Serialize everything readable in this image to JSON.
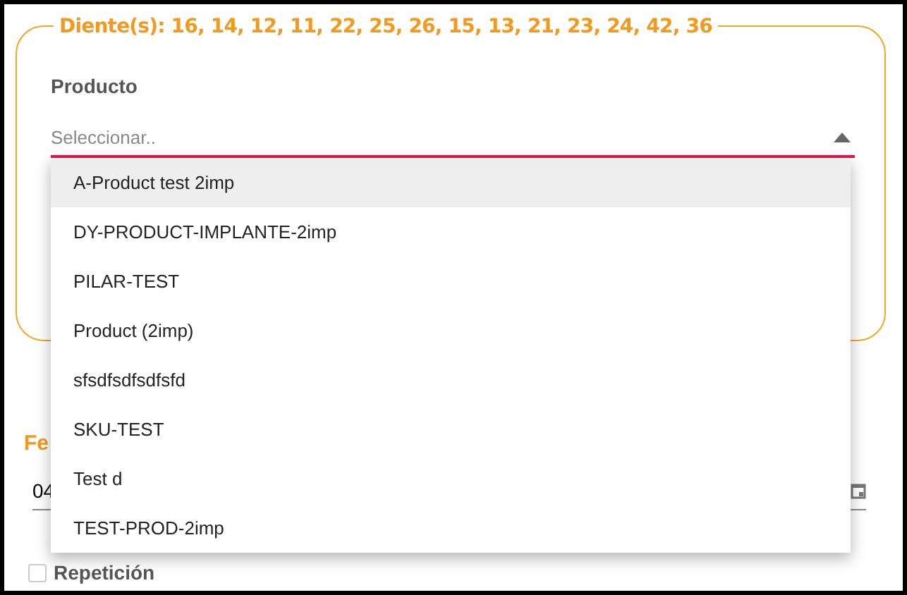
{
  "fieldset": {
    "legend": "Diente(s): 16, 14, 12, 11, 22, 25, 26, 15, 13, 21, 23, 24, 42, 36"
  },
  "product_select": {
    "label": "Producto",
    "placeholder": "Seleccionar..",
    "expanded": true,
    "options": [
      {
        "label": "A-Product test 2imp",
        "selected": true
      },
      {
        "label": "DY-PRODUCT-IMPLANTE-2imp",
        "selected": false
      },
      {
        "label": "PILAR-TEST",
        "selected": false
      },
      {
        "label": "Product (2imp)",
        "selected": false
      },
      {
        "label": "sfsdfsdfsdfsfd",
        "selected": false
      },
      {
        "label": "SKU-TEST",
        "selected": false
      },
      {
        "label": "Test d",
        "selected": false
      },
      {
        "label": "TEST-PROD-2imp",
        "selected": false
      }
    ]
  },
  "date": {
    "label": "Fe",
    "value": "04"
  },
  "repeat": {
    "label": "Repetición",
    "checked": false
  }
}
